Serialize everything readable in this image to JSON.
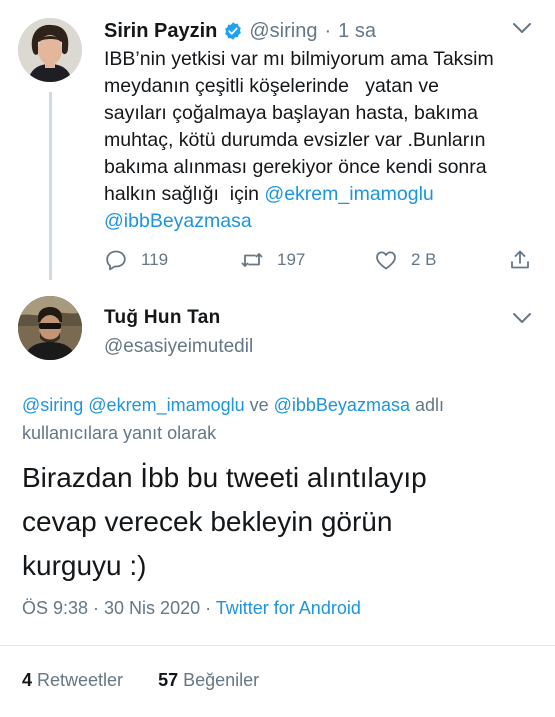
{
  "tweet1": {
    "name": "Sirin Payzin",
    "handle": "@siring",
    "separator": "·",
    "time": "1 sa",
    "lines": [
      "IBB’nin yetkisi var mı bilmiyorum ama Taksim",
      "meydanın çeşitli köşelerinde   yatan ve",
      "sayıları çoğalmaya başlayan hasta, bakıma",
      "muhtaç, kötü durumda evsizler var .Bunların",
      "bakıma alınması gerekiyor önce kendi sonra"
    ],
    "line6_text": "halkın sağlığı  için ",
    "mention1": "@ekrem_imamoglu",
    "mention2": "@ibbBeyazmasa",
    "replies": "119",
    "retweets": "197",
    "likes": "2 B"
  },
  "tweet2": {
    "name": "Tuğ Hun Tan",
    "handle": "@esasiyeimutedil",
    "reply_prefix_mentions": "@siring @ekrem_imamoglu",
    "reply_and": " ve ",
    "reply_mention3": "@ibbBeyazmasa",
    "reply_suffix": " adlı",
    "reply_line2": "kullanıcılara yanıt olarak",
    "text_lines": [
      "Birazdan İbb bu tweeti alıntılayıp",
      "cevap verecek bekleyin görün",
      "kurguyu :)"
    ],
    "timestamp": "ÖS 9:38 · 30 Nis 2020 · ",
    "source": "Twitter for Android",
    "retweet_count": "4",
    "retweet_label": " Retweetler",
    "like_count": "57",
    "like_label": " Beğeniler"
  },
  "colors": {
    "link": "#1b95e0",
    "secondary": "#657786",
    "primary": "#14171a",
    "divider": "#e1e8ed"
  },
  "icons": [
    "verified-badge-icon",
    "chevron-down-icon",
    "reply-icon",
    "retweet-icon",
    "like-icon",
    "share-icon"
  ]
}
